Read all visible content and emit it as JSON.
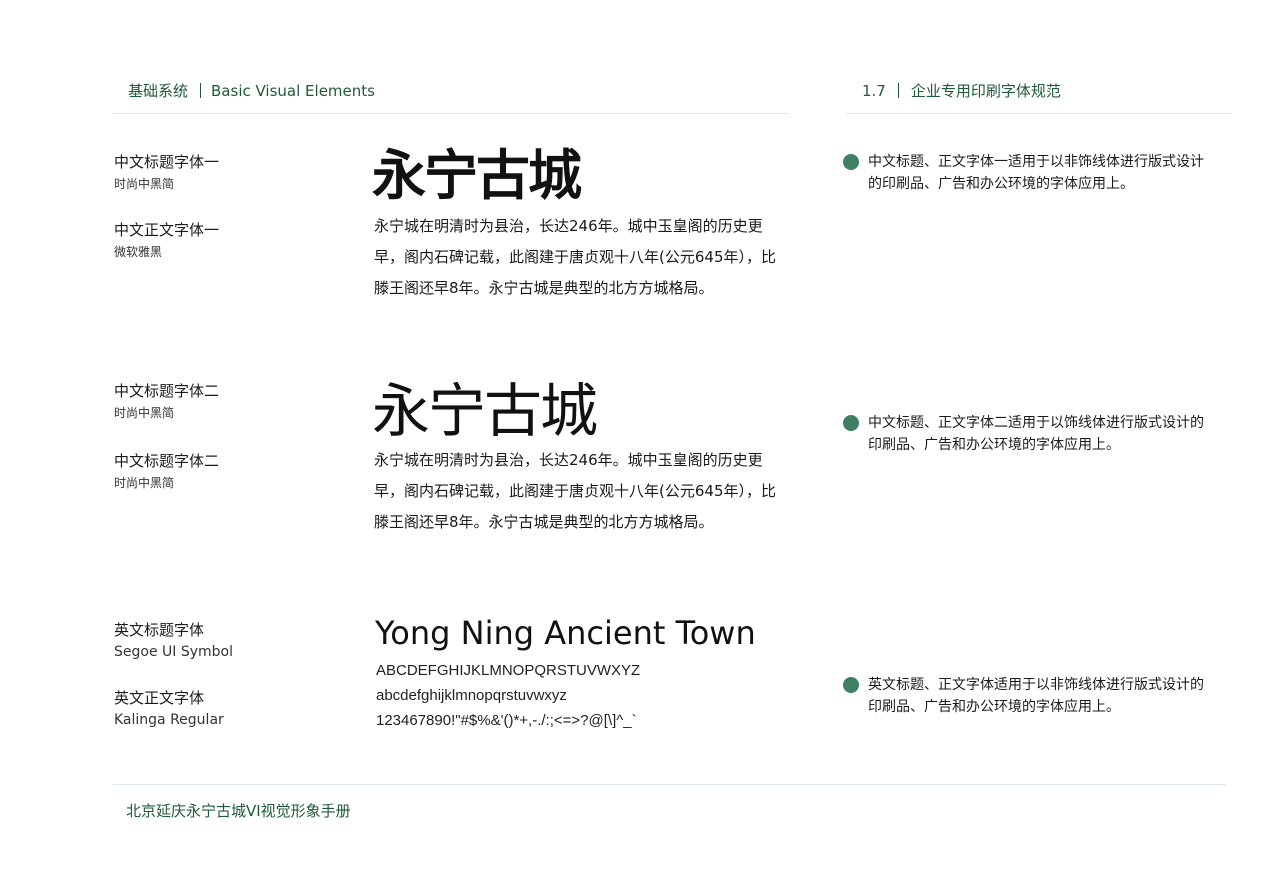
{
  "header": {
    "section_cn": "基础系统",
    "section_en": "Basic Visual Elements",
    "page_number": "1.7",
    "page_title": "企业专用印刷字体规范"
  },
  "rows": [
    {
      "title_font": {
        "name": "中文标题字体一",
        "font": "时尚中黑简"
      },
      "body_font": {
        "name": "中文正文字体一",
        "font": "微软雅黑"
      },
      "sample_title": "永宁古城",
      "sample_body": "永宁城在明清时为县治，长达246年。城中玉皇阁的历史更早，阁内石碑记载，此阁建于唐贞观十八年(公元645年），比滕王阁还早8年。永宁古城是典型的北方方城格局。",
      "note": "中文标题、正文字体一适用于以非饰线体进行版式设计的印刷品、广告和办公环境的字体应用上。"
    },
    {
      "title_font": {
        "name": "中文标题字体二",
        "font": "时尚中黑简"
      },
      "body_font": {
        "name": "中文标题字体二",
        "font": "时尚中黑简"
      },
      "sample_title": "永宁古城",
      "sample_body": "永宁城在明清时为县治，长达246年。城中玉皇阁的历史更早，阁内石碑记载，此阁建于唐贞观十八年(公元645年），比滕王阁还早8年。永宁古城是典型的北方方城格局。",
      "note": "中文标题、正文字体二适用于以饰线体进行版式设计的印刷品、广告和办公环境的字体应用上。"
    },
    {
      "title_font": {
        "name": "英文标题字体",
        "font": "Segoe UI Symbol"
      },
      "body_font": {
        "name": "英文正文字体",
        "font": "Kalinga Regular"
      },
      "sample_title": "Yong Ning Ancient Town",
      "sample_lines": [
        "ABCDEFGHIJKLMNOPQRSTUVWXYZ",
        "abcdefghijklmnopqrstuvwxyz",
        "123467890!\"#$%&'()*+,-./:;<=>?@[\\]^_`"
      ],
      "note": "英文标题、正文字体适用于以非饰线体进行版式设计的印刷品、广告和办公环境的字体应用上。"
    }
  ],
  "footer": {
    "text": "北京延庆永宁古城VI视觉形象手册"
  },
  "colors": {
    "accent": "#1f5a3a",
    "dot": "#3f7f63",
    "rule": "#e4e4e4"
  }
}
